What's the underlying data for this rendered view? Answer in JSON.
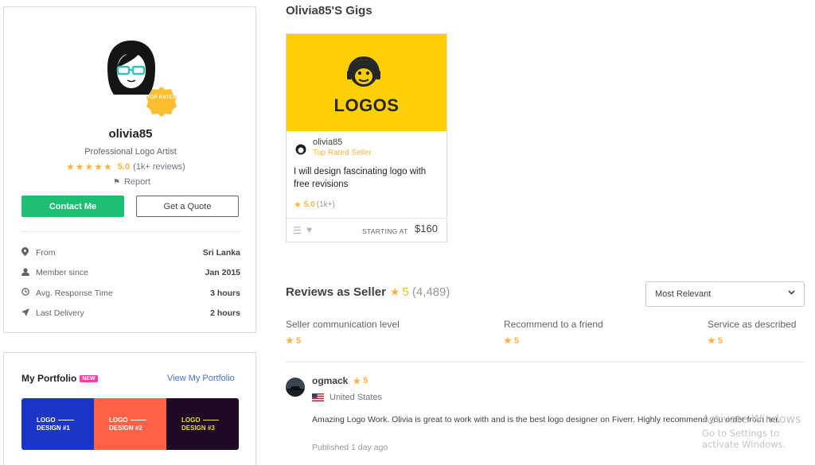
{
  "profile": {
    "username": "olivia85",
    "tagline": "Professional Logo Artist",
    "badge_text": "TOP RATED",
    "rating_score": "5.0",
    "rating_reviews": "(1k+ reviews)",
    "report_label": "Report",
    "contact_button": "Contact Me",
    "quote_button": "Get a Quote",
    "info": [
      {
        "icon": "location-icon",
        "label": "From",
        "value": "Sri Lanka"
      },
      {
        "icon": "user-icon",
        "label": "Member since",
        "value": "Jan 2015"
      },
      {
        "icon": "clock-icon",
        "label": "Avg. Response Time",
        "value": "3 hours"
      },
      {
        "icon": "send-icon",
        "label": "Last Delivery",
        "value": "2 hours"
      }
    ]
  },
  "portfolio": {
    "title": "My Portfolio",
    "badge": "NEW",
    "view_link": "View My Portfolio",
    "tiles": [
      {
        "line1": "LOGO",
        "line2": "DESIGN #1"
      },
      {
        "line1": "LOGO",
        "line2": "DESIGN #2"
      },
      {
        "line1": "LOGO",
        "line2": "DESIGN #3"
      }
    ]
  },
  "gigs": {
    "heading": "Olivia85'S Gigs",
    "card": {
      "thumb_text": "LOGOS",
      "seller_name": "olivia85",
      "seller_level": "Top Rated Seller",
      "title": "I will design fascinating logo with free revisions",
      "rating": "5.0",
      "rating_count": "(1k+)",
      "starting_label": "STARTING AT",
      "price": "$160"
    }
  },
  "reviews": {
    "heading": "Reviews as Seller",
    "score": "5",
    "count": "(4,489)",
    "sort_selected": "Most Relevant",
    "criteria": [
      {
        "label": "Seller communication level",
        "score": "5"
      },
      {
        "label": "Recommend to a friend",
        "score": "5"
      },
      {
        "label": "Service as described",
        "score": "5"
      }
    ],
    "items": [
      {
        "name": "ogmack",
        "score": "5",
        "country": "United States",
        "text": "Amazing Logo Work. Olivia is great to work with and is the best logo designer on Fiverr. Highly recommend you order from her.",
        "date": "Published 1 day ago"
      }
    ]
  },
  "watermark": {
    "line1": "Activate Windows",
    "line2": "Go to Settings to activate Windows."
  },
  "colors": {
    "accent_green": "#1dbf73",
    "star": "#ffb33e",
    "link": "#446ee7",
    "gig_thumb": "#ffcf06"
  }
}
